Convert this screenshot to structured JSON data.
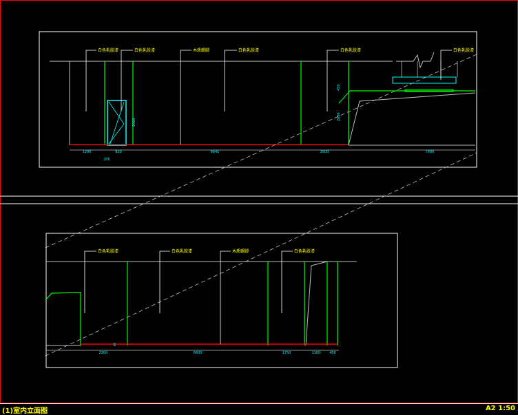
{
  "colors": {
    "background": "#000000",
    "frame": "#ffffff",
    "wall_line": "#00ff00",
    "floor_line": "#ff0000",
    "door": "#00ffff",
    "label": "#ffff00",
    "dimension_text": "#00ffff",
    "ceiling": "#c0c0c0"
  },
  "upper_elevation": {
    "callouts": [
      "白色乳胶漆",
      "白色乳胶漆",
      "木质踢脚",
      "白色乳胶漆",
      "白色乳胶漆",
      "白色乳胶漆"
    ],
    "dimensions": [
      "1200",
      "850",
      "6645",
      "2500",
      "7800"
    ],
    "sub_dimension": "200",
    "door_height": "2000",
    "wall_height": "2600",
    "side_height": "450"
  },
  "lower_elevation": {
    "callouts": [
      "白色乳胶漆",
      "白色乳胶漆",
      "木质踢脚",
      "白色乳胶漆"
    ],
    "dimensions": [
      "2300",
      "6800",
      "1750",
      "1100",
      "450"
    ],
    "small_mark": "80"
  },
  "status": {
    "title": "(1)室内立面图",
    "scale": "A2 1:50"
  }
}
